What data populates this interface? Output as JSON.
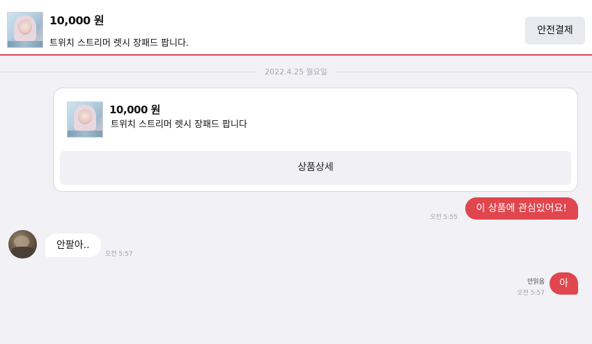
{
  "header": {
    "price": "10,000 원",
    "title": "트위치 스트리머 렛시 장패드 팝니다.",
    "pay_button": "안전결제"
  },
  "date_divider": "2022.4.25 월요일",
  "product_card": {
    "price": "10,000 원",
    "title": "트위치 스트리머 렛시 장패드 팝니다",
    "detail_button": "상품상세"
  },
  "messages": [
    {
      "sender": "me",
      "text": "이 상품에 관심있어요!",
      "time": "오전 5:55"
    },
    {
      "sender": "other",
      "text": "안팔아..",
      "time": "오전 5:57"
    },
    {
      "sender": "me",
      "text": "아",
      "time": "오전 5:57",
      "status": "안읽음"
    }
  ],
  "colors": {
    "accent": "#e0464e",
    "background": "#f1f1f6",
    "button_bg": "#e9e9f0"
  }
}
